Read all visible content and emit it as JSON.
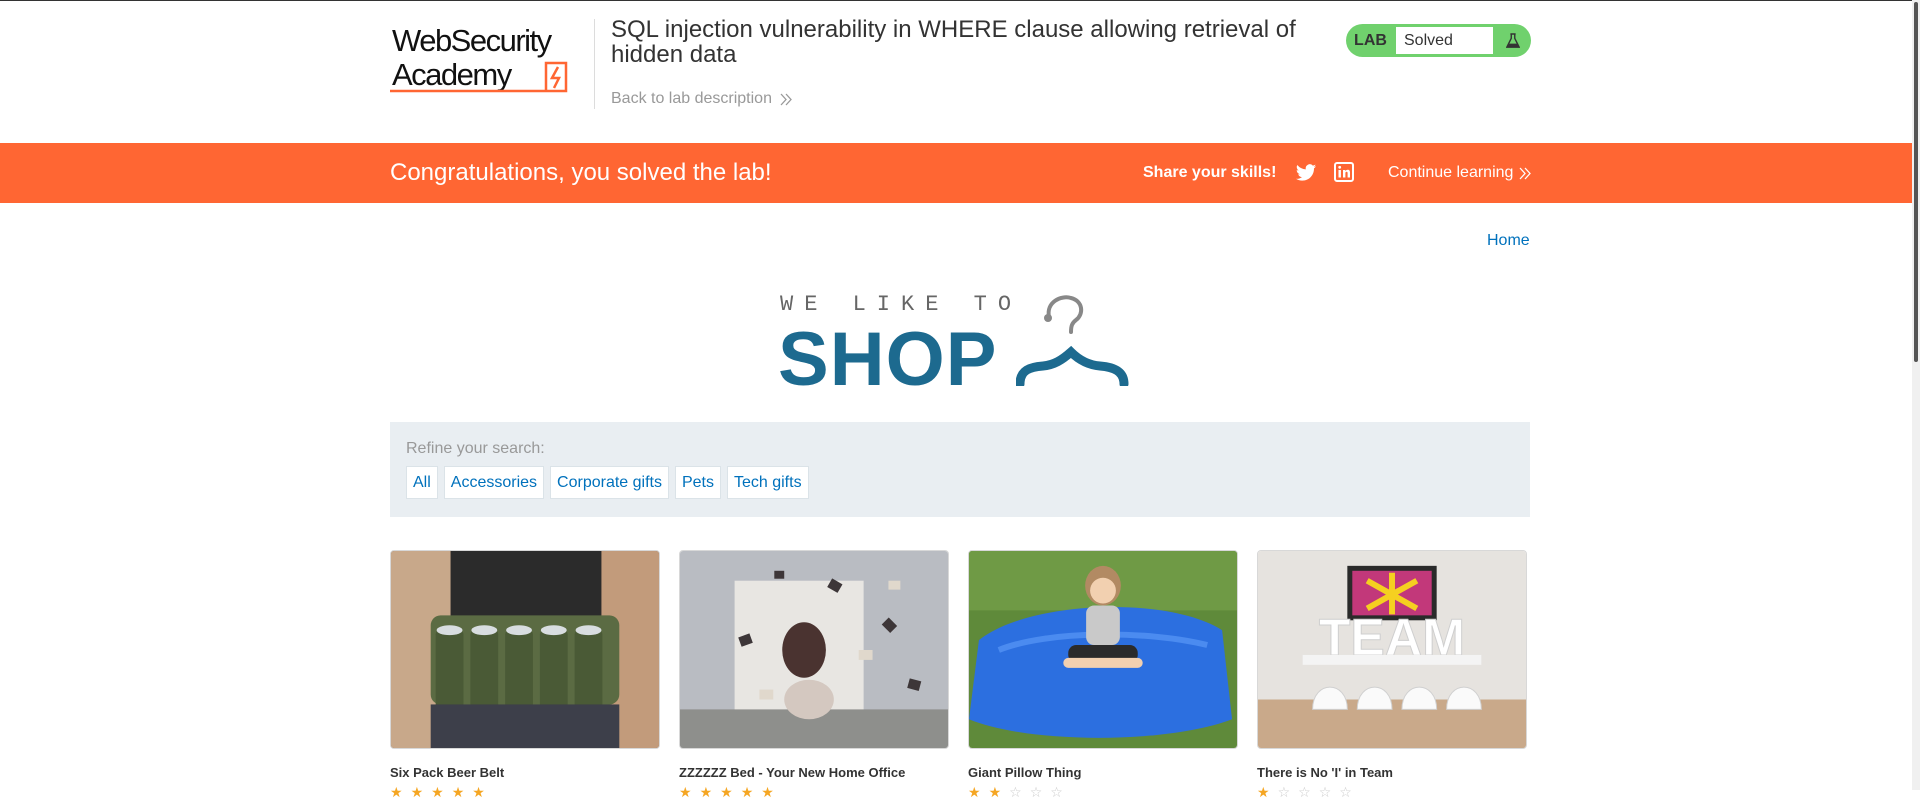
{
  "lab": {
    "logo_line1": "WebSecurity",
    "logo_line2": "Academy",
    "title": "SQL injection vulnerability in WHERE clause allowing retrieval of hidden data",
    "back_label": "Back to lab description",
    "status_tag": "LAB",
    "status_value": "Solved",
    "status_icon": "flask-icon"
  },
  "banner": {
    "message": "Congratulations, you solved the lab!",
    "share_label": "Share your skills!",
    "continue_label": "Continue learning"
  },
  "shop": {
    "home_label": "Home",
    "tagline": "WE LIKE TO",
    "brand": "SHOP"
  },
  "filters": {
    "title": "Refine your search:",
    "items": [
      "All",
      "Accessories",
      "Corporate gifts",
      "Pets",
      "Tech gifts"
    ]
  },
  "products": [
    {
      "name": "Six Pack Beer Belt",
      "rating": 5
    },
    {
      "name": "ZZZZZZ Bed - Your New Home Office",
      "rating": 5
    },
    {
      "name": "Giant Pillow Thing",
      "rating": 2
    },
    {
      "name": "There is No 'I' in Team",
      "rating": 1
    }
  ],
  "colors": {
    "banner": "#ff6633",
    "lab_green": "#70d16d",
    "link_blue": "#0071bc",
    "shop_blue": "#1d6a8f",
    "filter_bg": "#e9eef2",
    "star": "#f5a623"
  }
}
